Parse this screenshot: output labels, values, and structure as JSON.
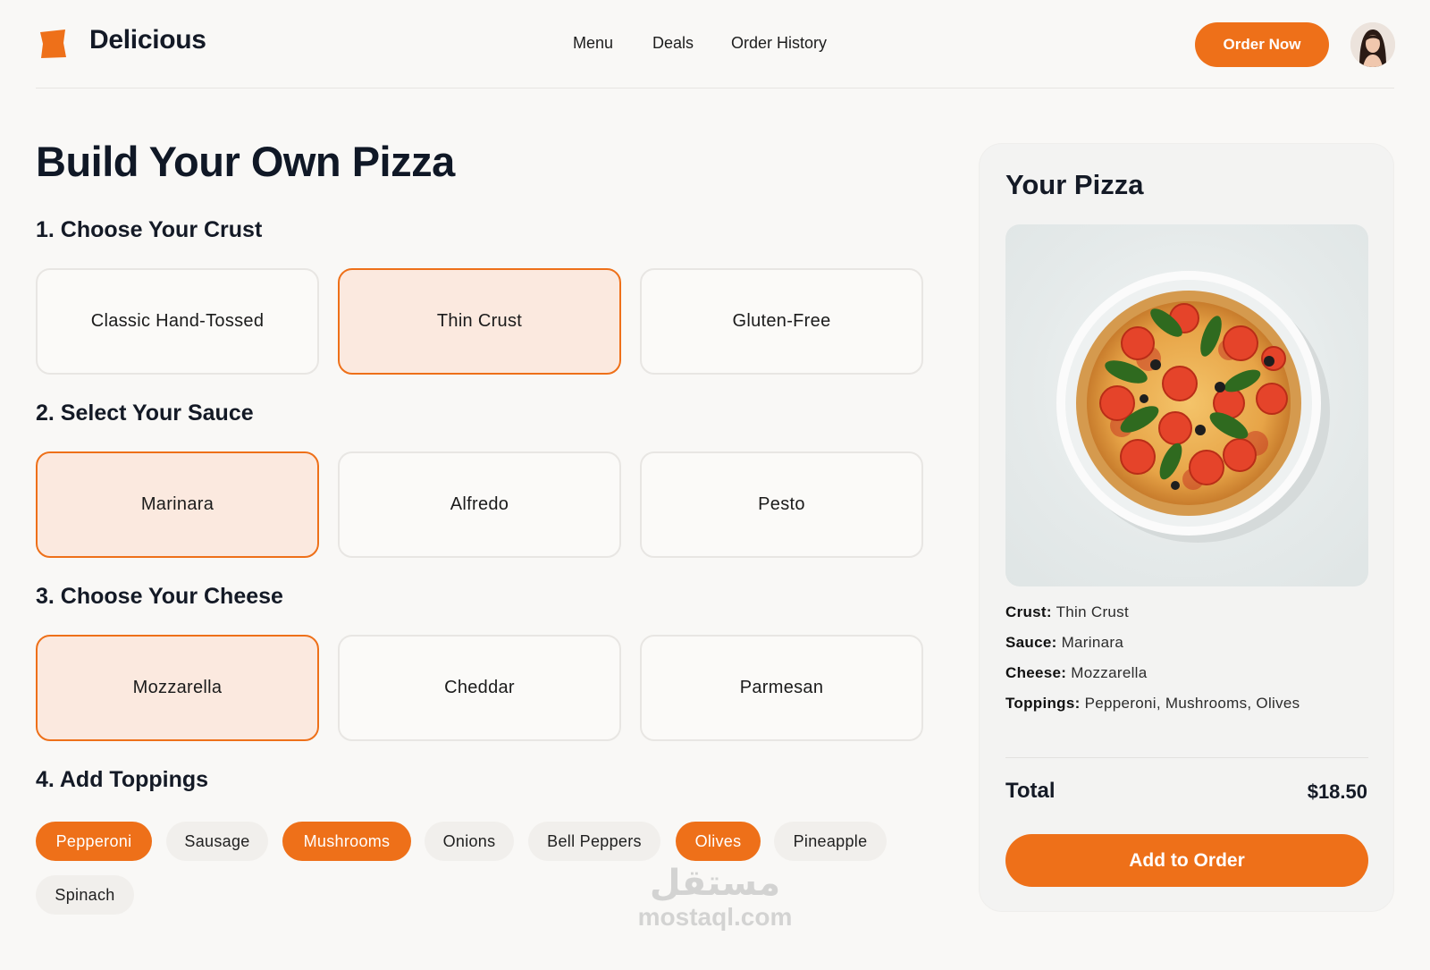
{
  "header": {
    "brand": "Delicious",
    "nav": [
      "Menu",
      "Deals",
      "Order History"
    ],
    "cta": "Order Now",
    "accent": "#ee7019"
  },
  "builder": {
    "title": "Build Your Own Pizza",
    "sections": [
      {
        "title": "1. Choose Your Crust",
        "options": [
          "Classic Hand-Tossed",
          "Thin Crust",
          "Gluten-Free"
        ],
        "selected": "Thin Crust"
      },
      {
        "title": "2. Select Your Sauce",
        "options": [
          "Marinara",
          "Alfredo",
          "Pesto"
        ],
        "selected": "Marinara"
      },
      {
        "title": "3. Choose Your Cheese",
        "options": [
          "Mozzarella",
          "Cheddar",
          "Parmesan"
        ],
        "selected": "Mozzarella"
      }
    ],
    "toppings_title": "4. Add Toppings",
    "toppings": [
      "Pepperoni",
      "Sausage",
      "Mushrooms",
      "Onions",
      "Bell Peppers",
      "Olives",
      "Pineapple",
      "Spinach"
    ],
    "toppings_selected": [
      "Pepperoni",
      "Mushrooms",
      "Olives"
    ]
  },
  "summary": {
    "title": "Your Pizza",
    "rows": [
      {
        "label": "Crust:",
        "value": "Thin Crust"
      },
      {
        "label": "Sauce:",
        "value": "Marinara"
      },
      {
        "label": "Cheese:",
        "value": "Mozzarella"
      },
      {
        "label": "Toppings:",
        "value": "Pepperoni, Mushrooms, Olives"
      }
    ],
    "total_label": "Total",
    "total_value": "$18.50",
    "button": "Add to Order"
  },
  "watermark": {
    "arabic": "مستقل",
    "latin": "mostaql.com"
  }
}
